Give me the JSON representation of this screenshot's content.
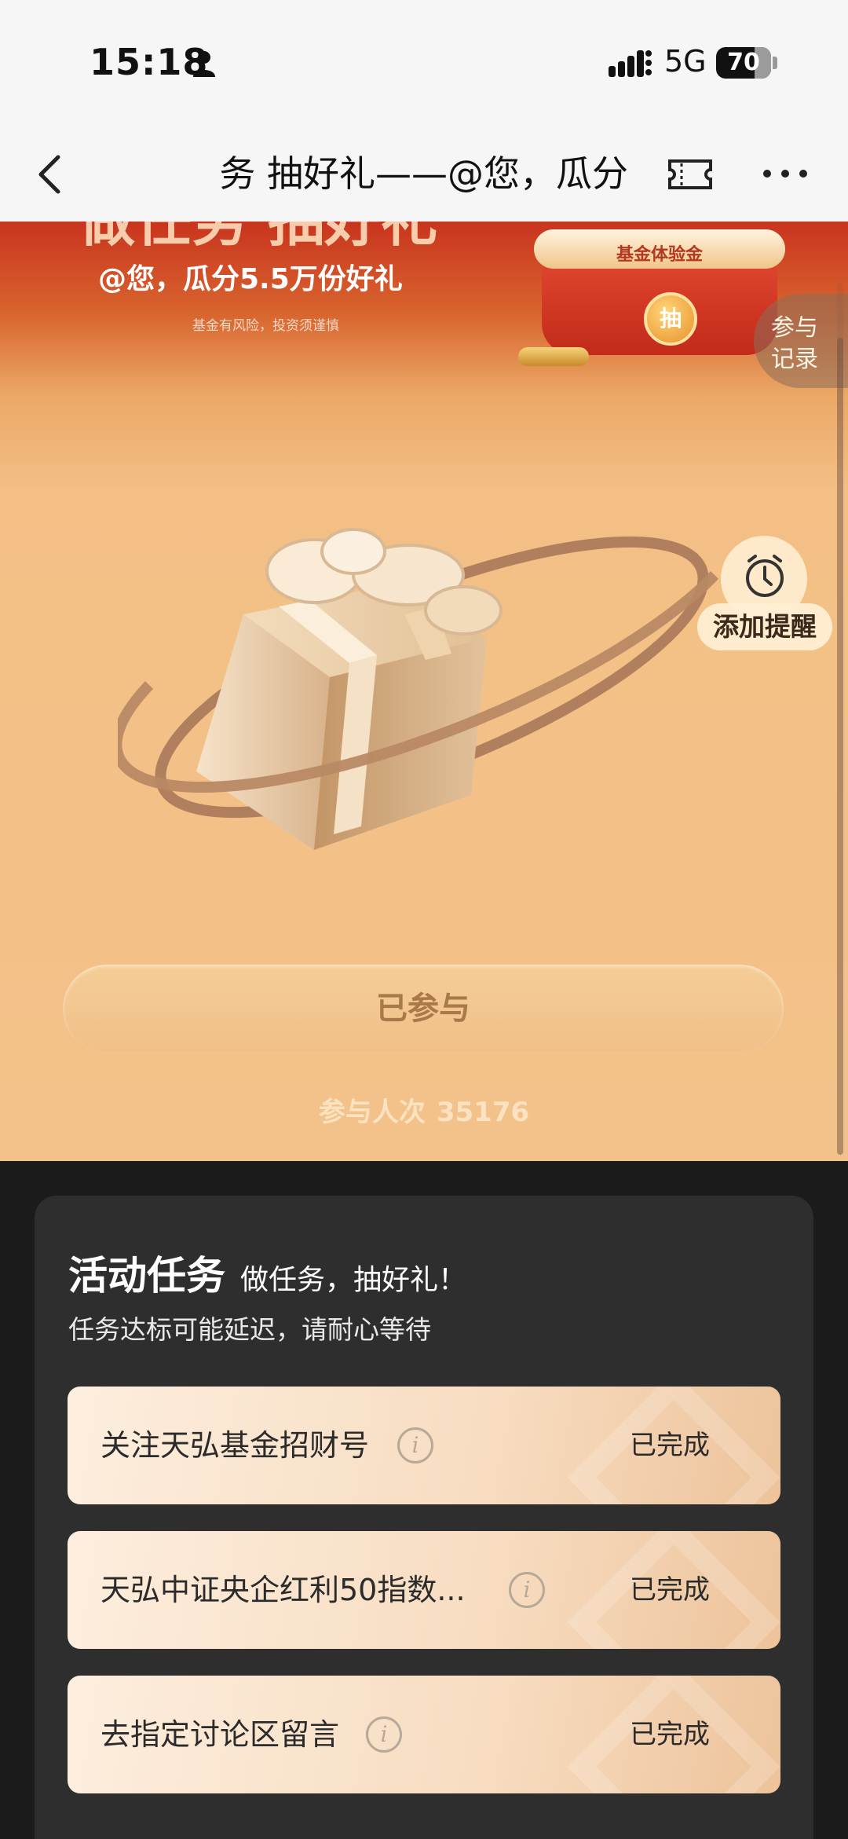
{
  "status_bar": {
    "time": "15:18",
    "network": "5G",
    "battery": "70",
    "battery_level": 0.7
  },
  "nav": {
    "title": "务 抽好礼——@您，瓜分"
  },
  "hero": {
    "headline_clipped": "做任务 抽好礼",
    "subtitle": "@您，瓜分5.5万份好礼",
    "risk_note": "基金有风险，投资须谨慎",
    "pot_label": "基金体验金",
    "pot_button": "抽",
    "records_line1": "参与",
    "records_line2": "记录",
    "remind_label": "添加提醒",
    "joined_button": "已参与",
    "participants_label": "参与人次",
    "participants_count": "35176"
  },
  "tasks": {
    "title": "活动任务",
    "subtitle": "做任务，抽好礼！",
    "note": "任务达标可能延迟，请耐心等待",
    "items": [
      {
        "name": "关注天弘基金招财号",
        "status": "已完成"
      },
      {
        "name": "天弘中证央企红利50指数...",
        "status": "已完成"
      },
      {
        "name": "去指定讨论区留言",
        "status": "已完成"
      }
    ]
  },
  "colors": {
    "hero_top": "#c8341e",
    "hero_main": "#f3c28a",
    "panel_bg": "#2e2e2e",
    "page_bg": "#1c1b1b"
  }
}
